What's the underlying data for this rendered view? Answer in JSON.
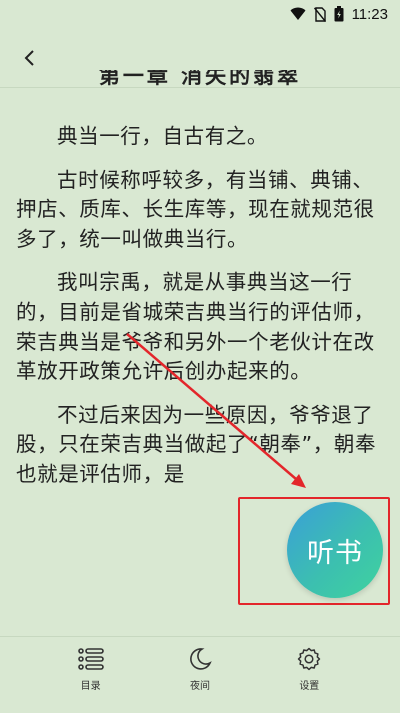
{
  "status_bar": {
    "time": "11:23"
  },
  "reader": {
    "chapter_title": "第一章 消失的翡翠",
    "paragraphs": [
      "典当一行，自古有之。",
      "古时候称呼较多，有当铺、典铺、押店、质库、长生库等，现在就规范很多了，统一叫做典当行。",
      "我叫宗禹，就是从事典当这一行的，目前是省城荣吉典当行的评估师，荣吉典当是爷爷和另外一个老伙计在改革放开政策允许后创办起来的。",
      "不过后来因为一些原因，爷爷退了股，只在荣吉典当做起了“朝奉”，朝奉也就是评估师，是"
    ]
  },
  "fab": {
    "label": "听书"
  },
  "bottom_nav": {
    "items": [
      {
        "label": "目录",
        "icon": "toc-icon"
      },
      {
        "label": "夜间",
        "icon": "moon-icon"
      },
      {
        "label": "设置",
        "icon": "gear-icon"
      }
    ]
  },
  "colors": {
    "background": "#d9e8d2",
    "annotation_red": "#e3262b",
    "fab_gradient_start": "#3a9fd8",
    "fab_gradient_end": "#3fd39e"
  }
}
